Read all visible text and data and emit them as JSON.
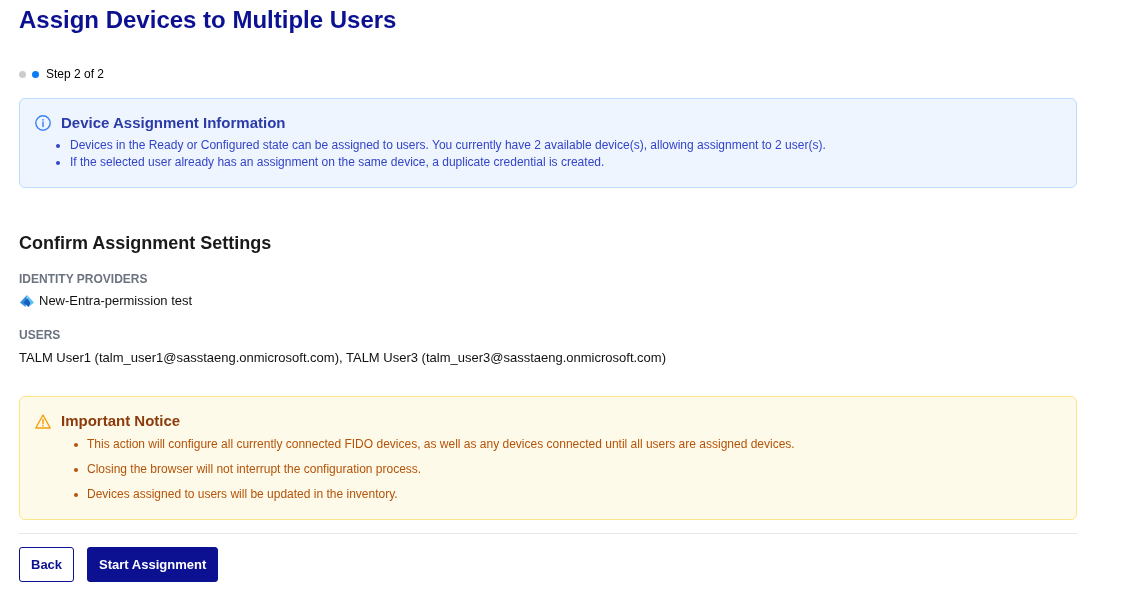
{
  "title": "Assign Devices to Multiple Users",
  "stepper": {
    "steps": [
      {
        "selected": false
      },
      {
        "selected": true
      }
    ],
    "label": "Step 2 of 2"
  },
  "info_box": {
    "title": "Device Assignment Information",
    "items": [
      "Devices in the Ready or Configured state can be assigned to users. You currently have 2 available device(s), allowing assignment to 2 user(s).",
      "If the selected user already has an assignment on the same device, a duplicate credential is created."
    ]
  },
  "settings": {
    "heading": "Confirm Assignment Settings",
    "identity_providers": {
      "label": "IDENTITY PROVIDERS",
      "items": [
        {
          "name": "New-Entra-permission test"
        }
      ]
    },
    "users": {
      "label": "USERS",
      "value": "TALM User1 (talm_user1@sasstaeng.onmicrosoft.com), TALM User3 (talm_user3@sasstaeng.onmicrosoft.com)"
    }
  },
  "notice": {
    "title": "Important Notice",
    "items": [
      "This action will configure all currently connected FIDO devices, as well as any devices connected until all users are assigned devices.",
      "Closing the browser will not interrupt the configuration process.",
      "Devices assigned to users will be updated in the inventory."
    ]
  },
  "buttons": [
    {
      "label": "Back",
      "kind": "secondary"
    },
    {
      "label": "Start Assignment",
      "kind": "primary"
    }
  ]
}
